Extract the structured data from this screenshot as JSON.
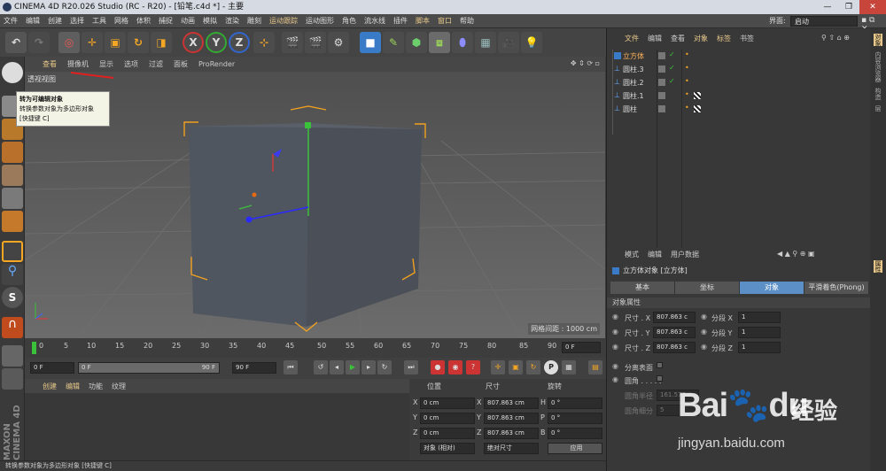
{
  "window": {
    "title": "CINEMA 4D R20.026 Studio (RC - R20) - [铅笔.c4d *] - 主要"
  },
  "menubar": {
    "items": [
      "文件",
      "编辑",
      "创建",
      "选择",
      "工具",
      "网格",
      "体积",
      "捕捉",
      "动画",
      "模拟",
      "渲染",
      "雕刻",
      "运动跟踪",
      "运动图形",
      "角色",
      "流水线",
      "插件",
      "脚本",
      "窗口",
      "帮助"
    ],
    "layout_label": "界面:",
    "layout_value": "启动"
  },
  "toolbar": {
    "axis_x": "X",
    "axis_y": "Y",
    "axis_z": "Z"
  },
  "viewport": {
    "menu": [
      "查看",
      "摄像机",
      "显示",
      "选项",
      "过滤",
      "面板",
      "ProRender"
    ],
    "label": "透视视图",
    "grid_info": "网格间距 : 1000 cm"
  },
  "tooltip": {
    "title": "转为可编辑对象",
    "desc": "转换参数对象为多边形对象",
    "shortcut": "[快捷键 C]"
  },
  "timeline": {
    "ticks": [
      "0",
      "5",
      "10",
      "15",
      "20",
      "25",
      "30",
      "35",
      "40",
      "45",
      "50",
      "55",
      "60",
      "65",
      "70",
      "75",
      "80",
      "85",
      "90"
    ],
    "end_frame": "0 F",
    "start": "0 F",
    "range_start": "0 F",
    "range_end": "90 F",
    "max": "90 F"
  },
  "material": {
    "menu": [
      "创建",
      "编辑",
      "功能",
      "纹理"
    ]
  },
  "coords": {
    "headers": [
      "位置",
      "尺寸",
      "旋转"
    ],
    "pos": [
      "0 cm",
      "0 cm",
      "0 cm"
    ],
    "size": [
      "807.863 cm",
      "807.863 cm",
      "807.863 cm"
    ],
    "rot": [
      "0 °",
      "0 °",
      "0 °"
    ],
    "pos_axes": [
      "X",
      "Y",
      "Z"
    ],
    "size_axes": [
      "X",
      "Y",
      "Z"
    ],
    "rot_axes": [
      "H",
      "P",
      "B"
    ],
    "mode1": "对象 (相对)",
    "mode2": "绝对尺寸",
    "apply": "应用"
  },
  "status": {
    "text": "转换参数对象为多边形对象 [快捷键 C]"
  },
  "objects": {
    "menu": [
      "文件",
      "编辑",
      "查看",
      "对象",
      "标签",
      "书签"
    ],
    "items": [
      {
        "name": "立方体",
        "selected": true
      },
      {
        "name": "圆柱.3",
        "selected": false
      },
      {
        "name": "圆柱.2",
        "selected": false
      },
      {
        "name": "圆柱.1",
        "selected": false
      },
      {
        "name": "圆柱",
        "selected": false
      }
    ]
  },
  "attributes": {
    "menu": [
      "模式",
      "编辑",
      "用户数据"
    ],
    "object_title": "立方体对象 [立方体]",
    "tabs": [
      "基本",
      "坐标",
      "对象",
      "平滑着色(Phong)"
    ],
    "section": "对象属性",
    "size_labels": [
      "尺寸 . X",
      "尺寸 . Y",
      "尺寸 . Z"
    ],
    "size_values": [
      "807.863 c",
      "807.863 c",
      "807.863 c"
    ],
    "seg_labels": [
      "分段 X",
      "分段 Y",
      "分段 Z"
    ],
    "seg_values": [
      "1",
      "1",
      "1"
    ],
    "sep_surface": "分离表面",
    "fillet": "圆角 . . . . .",
    "fillet_radius_label": "圆角半径",
    "fillet_radius": "161.573 c",
    "fillet_seg_label": "圆角细分",
    "fillet_seg": "5"
  },
  "sidetabs": [
    "对象",
    "内容浏览器",
    "构造",
    "层",
    "属性"
  ],
  "watermark": {
    "brand": "Bai",
    "brand2": "du",
    "zh": "经验",
    "url": "jingyan.baidu.com"
  },
  "branding": {
    "vertical": "MAXON CINEMA 4D"
  }
}
